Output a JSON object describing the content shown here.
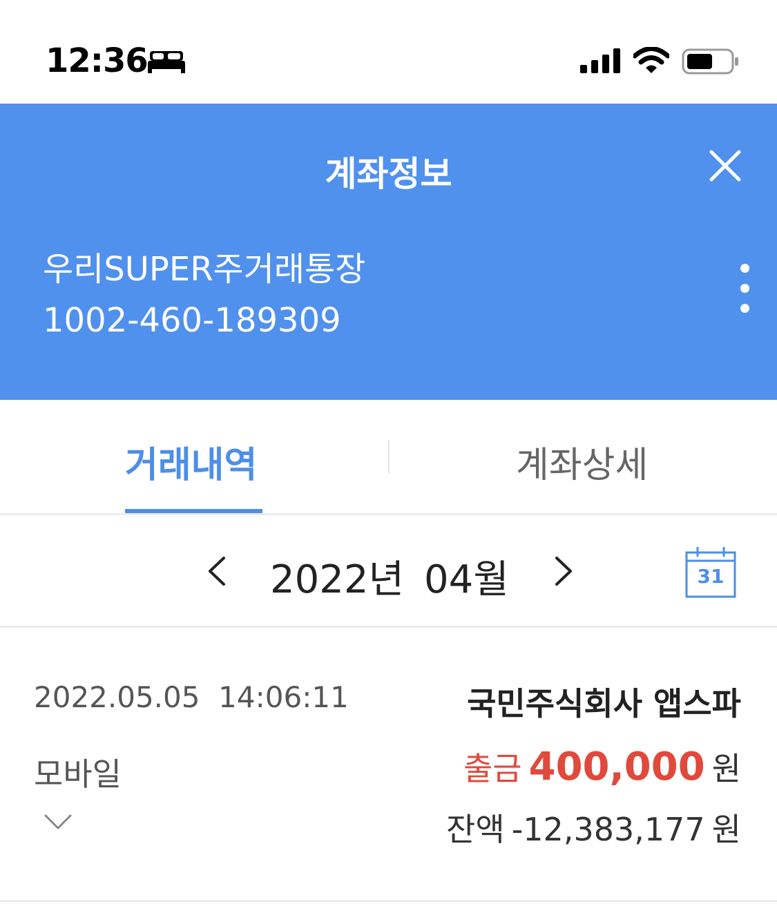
{
  "status_bar": {
    "time": "12:36",
    "icons": [
      "bed-icon",
      "signal-icon",
      "wifi-icon",
      "battery-icon"
    ]
  },
  "header": {
    "title": "계좌정보",
    "account_name": "우리SUPER주거래통장",
    "account_number": "1002-460-189309",
    "background_color": "#5091ee"
  },
  "tabs": [
    {
      "label": "거래내역",
      "active": true
    },
    {
      "label": "계좌상세",
      "active": false
    }
  ],
  "month_nav": {
    "year": "2022년",
    "month": "04월",
    "calendar_day": "31"
  },
  "transactions": [
    {
      "datetime": "2022.05.05  14:06:11",
      "counterparty": "국민주식회사 앱스파",
      "channel": "모바일",
      "type": "출금",
      "amount": "400,000",
      "currency": "원",
      "balance_label": "잔액",
      "balance": "-12,383,177",
      "balance_currency": "원"
    }
  ],
  "colors": {
    "accent": "#4d8ee8",
    "withdrawal": "#e0493c"
  }
}
